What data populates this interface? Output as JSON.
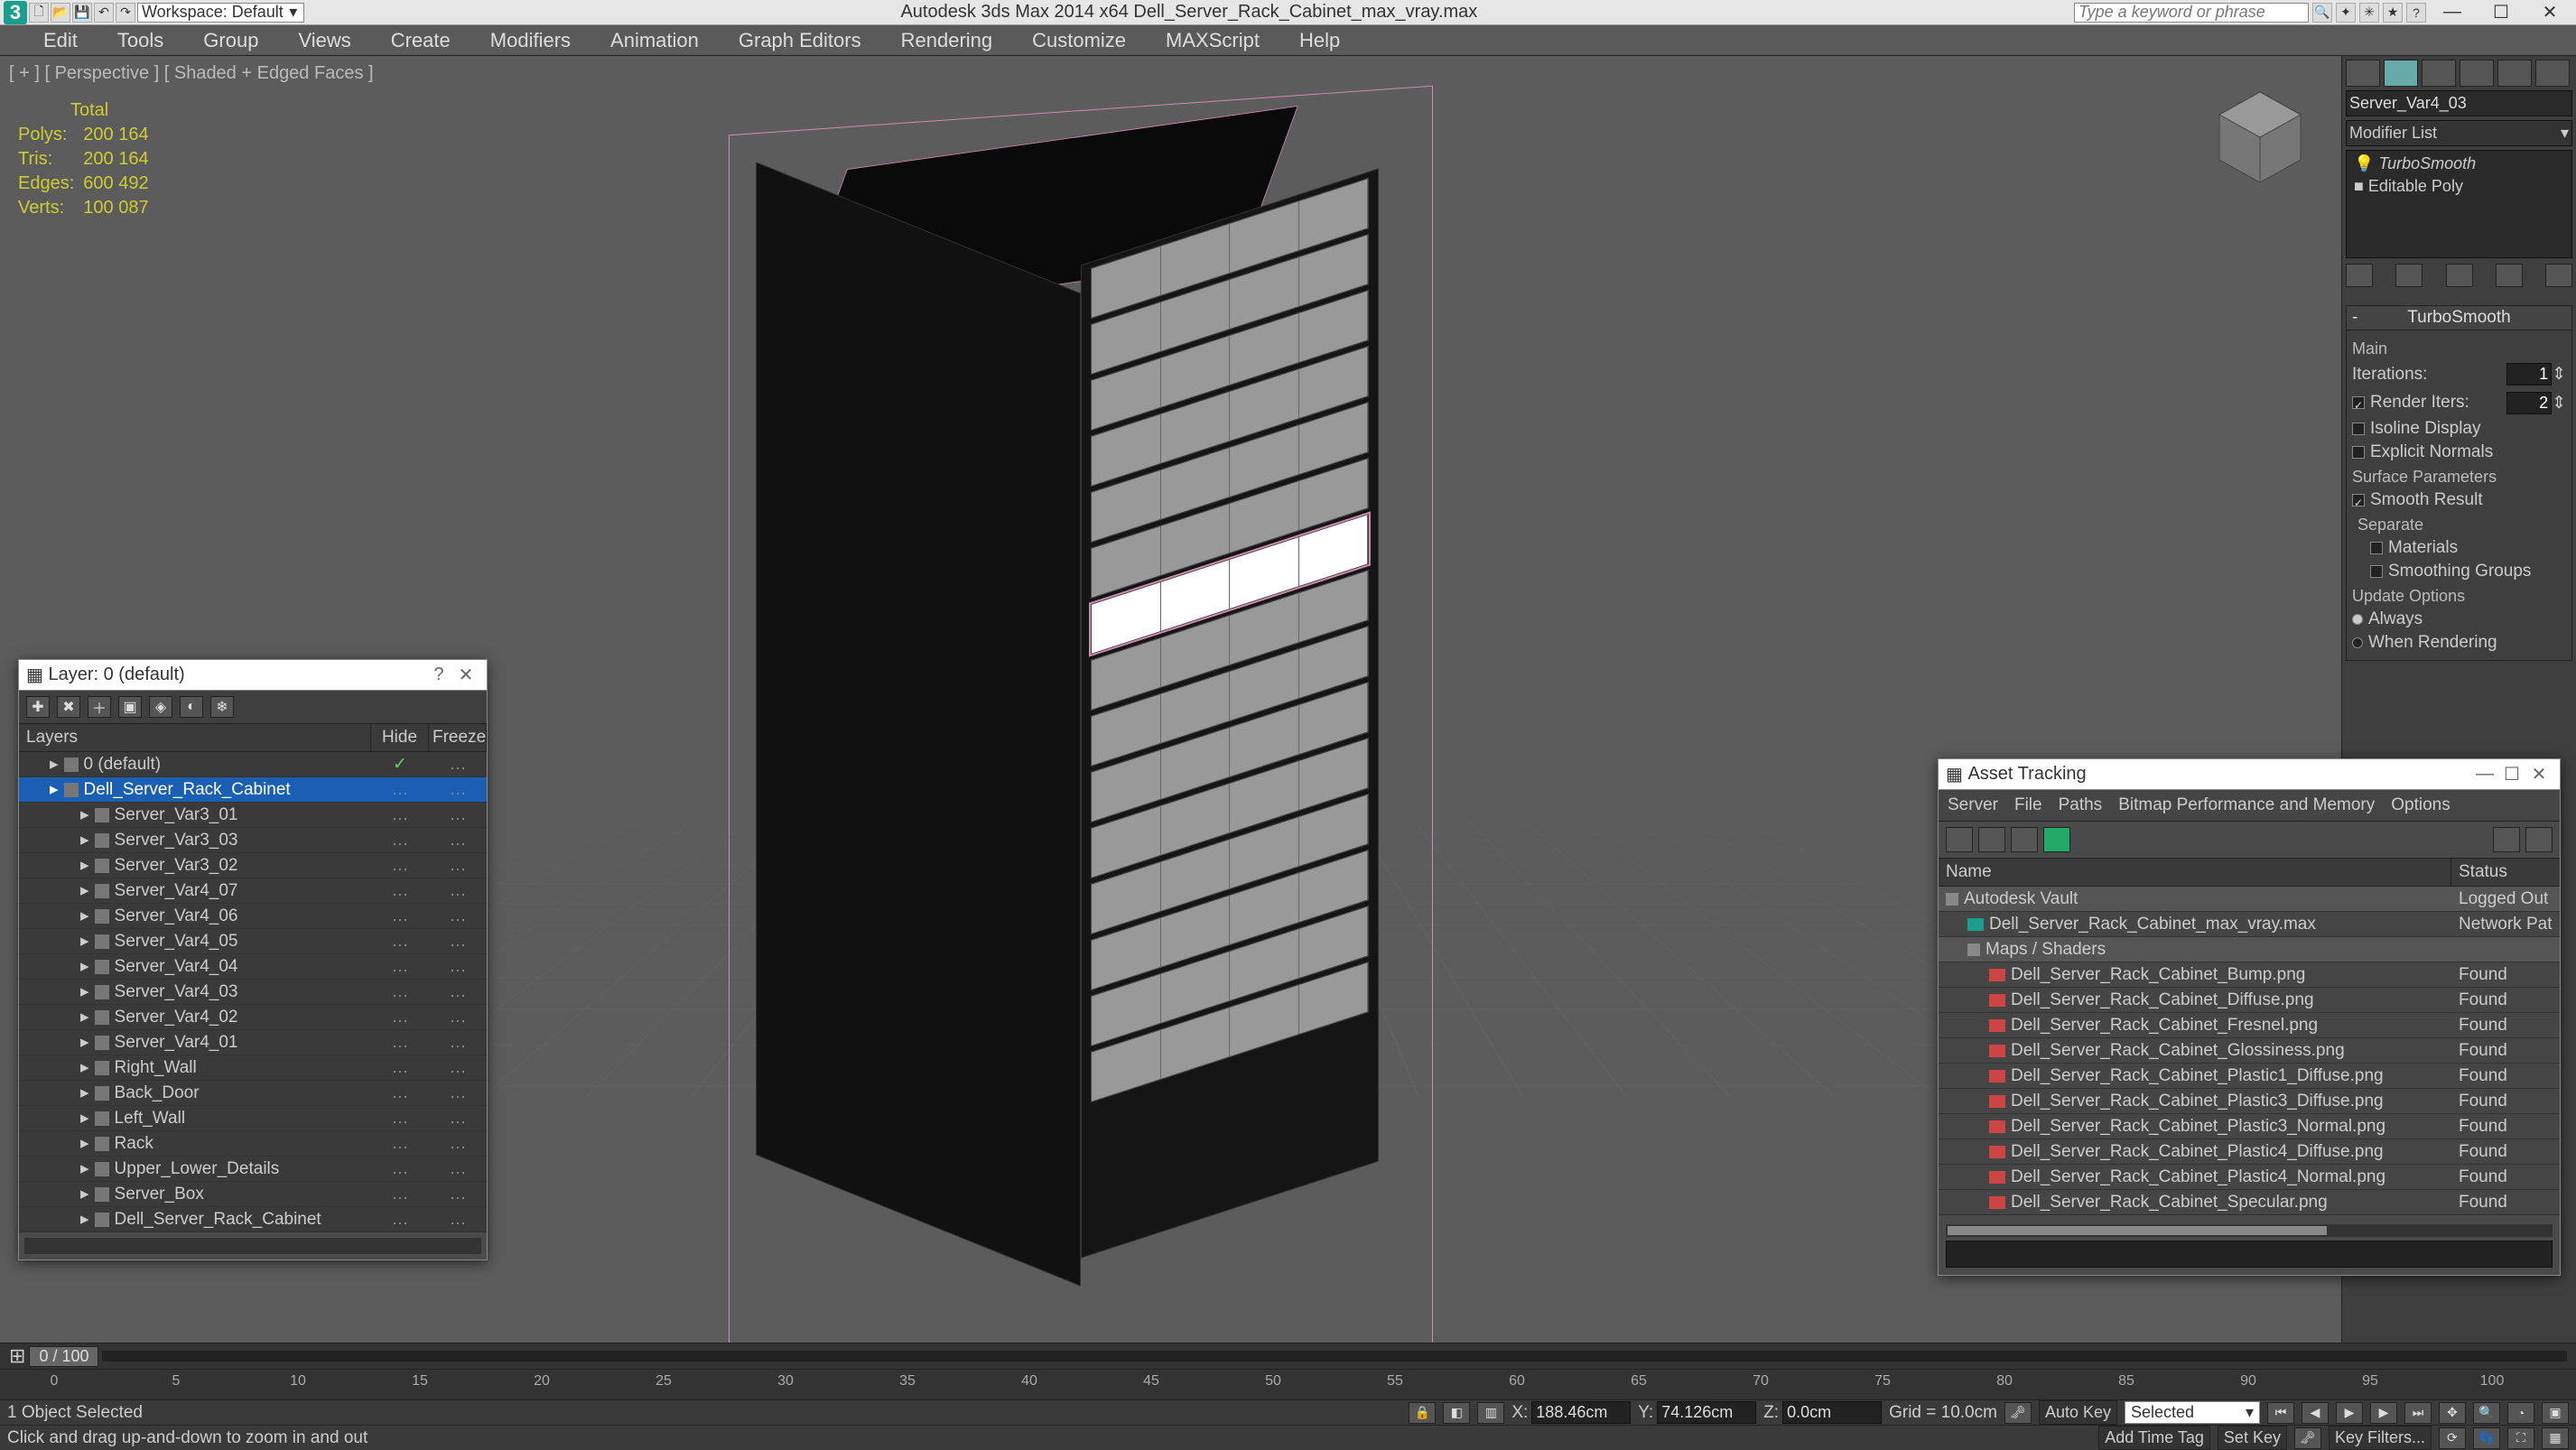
{
  "title_bar": {
    "app_label": "3",
    "workspace": "Workspace: Default",
    "center_title": "Autodesk 3ds Max  2014 x64      Dell_Server_Rack_Cabinet_max_vray.max",
    "search_placeholder": "Type a keyword or phrase"
  },
  "menu": [
    "Edit",
    "Tools",
    "Group",
    "Views",
    "Create",
    "Modifiers",
    "Animation",
    "Graph Editors",
    "Rendering",
    "Customize",
    "MAXScript",
    "Help"
  ],
  "viewport": {
    "header": "[ + ] [ Perspective ] [ Shaded + Edged Faces ]",
    "stats_title": "Total",
    "stats": [
      {
        "label": "Polys:",
        "value": "200 164"
      },
      {
        "label": "Tris:",
        "value": "200 164"
      },
      {
        "label": "Edges:",
        "value": "600 492"
      },
      {
        "label": "Verts:",
        "value": "100 087"
      }
    ]
  },
  "command_panel": {
    "object_name": "Server_Var4_03",
    "modifier_list_label": "Modifier List",
    "stack": [
      "TurboSmooth",
      "Editable Poly"
    ],
    "rollout_name": "TurboSmooth",
    "group_main": "Main",
    "iterations_label": "Iterations:",
    "iterations_value": "1",
    "render_iters_label": "Render Iters:",
    "render_iters_value": "2",
    "render_iters_checked": true,
    "isoline_label": "Isoline Display",
    "explicit_label": "Explicit Normals",
    "group_surface": "Surface Parameters",
    "smooth_result_label": "Smooth Result",
    "separate_label": "Separate",
    "sep_materials": "Materials",
    "sep_smoothing": "Smoothing Groups",
    "group_update": "Update Options",
    "opt_always": "Always",
    "opt_render": "When Rendering"
  },
  "layer_dialog": {
    "title": "Layer: 0 (default)",
    "cols": {
      "name": "Layers",
      "hide": "Hide",
      "freeze": "Freeze"
    },
    "rows": [
      {
        "indent": 1,
        "name": "0 (default)",
        "selected": false,
        "hide": "chk",
        "freeze": ""
      },
      {
        "indent": 1,
        "name": "Dell_Server_Rack_Cabinet",
        "selected": true,
        "hide": "",
        "freeze": ""
      },
      {
        "indent": 2,
        "name": "Server_Var3_01"
      },
      {
        "indent": 2,
        "name": "Server_Var3_03"
      },
      {
        "indent": 2,
        "name": "Server_Var3_02"
      },
      {
        "indent": 2,
        "name": "Server_Var4_07"
      },
      {
        "indent": 2,
        "name": "Server_Var4_06"
      },
      {
        "indent": 2,
        "name": "Server_Var4_05"
      },
      {
        "indent": 2,
        "name": "Server_Var4_04"
      },
      {
        "indent": 2,
        "name": "Server_Var4_03"
      },
      {
        "indent": 2,
        "name": "Server_Var4_02"
      },
      {
        "indent": 2,
        "name": "Server_Var4_01"
      },
      {
        "indent": 2,
        "name": "Right_Wall"
      },
      {
        "indent": 2,
        "name": "Back_Door"
      },
      {
        "indent": 2,
        "name": "Left_Wall"
      },
      {
        "indent": 2,
        "name": "Rack"
      },
      {
        "indent": 2,
        "name": "Upper_Lower_Details"
      },
      {
        "indent": 2,
        "name": "Server_Box"
      },
      {
        "indent": 2,
        "name": "Dell_Server_Rack_Cabinet"
      }
    ]
  },
  "asset_tracking": {
    "title": "Asset Tracking",
    "menu": [
      "Server",
      "File",
      "Paths",
      "Bitmap Performance and Memory",
      "Options"
    ],
    "cols": {
      "name": "Name",
      "status": "Status"
    },
    "rows": [
      {
        "kind": "hdr",
        "icon": "fold",
        "name": "Autodesk Vault",
        "status": "Logged Out"
      },
      {
        "kind": "item",
        "icon": "max",
        "indent": 1,
        "name": "Dell_Server_Rack_Cabinet_max_vray.max",
        "status": "Network Pat"
      },
      {
        "kind": "hdr",
        "icon": "fold",
        "indent": 1,
        "name": "Maps / Shaders",
        "status": ""
      },
      {
        "kind": "item",
        "icon": "img",
        "indent": 2,
        "name": "Dell_Server_Rack_Cabinet_Bump.png",
        "status": "Found"
      },
      {
        "kind": "item",
        "icon": "img",
        "indent": 2,
        "name": "Dell_Server_Rack_Cabinet_Diffuse.png",
        "status": "Found"
      },
      {
        "kind": "item",
        "icon": "img",
        "indent": 2,
        "name": "Dell_Server_Rack_Cabinet_Fresnel.png",
        "status": "Found"
      },
      {
        "kind": "item",
        "icon": "img",
        "indent": 2,
        "name": "Dell_Server_Rack_Cabinet_Glossiness.png",
        "status": "Found"
      },
      {
        "kind": "item",
        "icon": "img",
        "indent": 2,
        "name": "Dell_Server_Rack_Cabinet_Plastic1_Diffuse.png",
        "status": "Found"
      },
      {
        "kind": "item",
        "icon": "img",
        "indent": 2,
        "name": "Dell_Server_Rack_Cabinet_Plastic3_Diffuse.png",
        "status": "Found"
      },
      {
        "kind": "item",
        "icon": "img",
        "indent": 2,
        "name": "Dell_Server_Rack_Cabinet_Plastic3_Normal.png",
        "status": "Found"
      },
      {
        "kind": "item",
        "icon": "img",
        "indent": 2,
        "name": "Dell_Server_Rack_Cabinet_Plastic4_Diffuse.png",
        "status": "Found"
      },
      {
        "kind": "item",
        "icon": "img",
        "indent": 2,
        "name": "Dell_Server_Rack_Cabinet_Plastic4_Normal.png",
        "status": "Found"
      },
      {
        "kind": "item",
        "icon": "img",
        "indent": 2,
        "name": "Dell_Server_Rack_Cabinet_Specular.png",
        "status": "Found"
      }
    ]
  },
  "timeline": {
    "frame_label": "0 / 100",
    "ticks": [
      "0",
      "5",
      "10",
      "15",
      "20",
      "25",
      "30",
      "35",
      "40",
      "45",
      "50",
      "55",
      "60",
      "65",
      "70",
      "75",
      "80",
      "85",
      "90",
      "95",
      "100"
    ]
  },
  "status": {
    "sel_info": "1 Object Selected",
    "x_label": "X:",
    "x_val": "188.46cm",
    "y_label": "Y:",
    "y_val": "74.126cm",
    "z_label": "Z:",
    "z_val": "0.0cm",
    "grid_label": "Grid = 10.0cm",
    "autokey": "Auto Key",
    "selected_dd": "Selected",
    "prompt": "Click and drag up-and-down to zoom in and out",
    "setkey": "Set Key",
    "keyfilters": "Key Filters...",
    "addtimetag": "Add Time Tag"
  }
}
